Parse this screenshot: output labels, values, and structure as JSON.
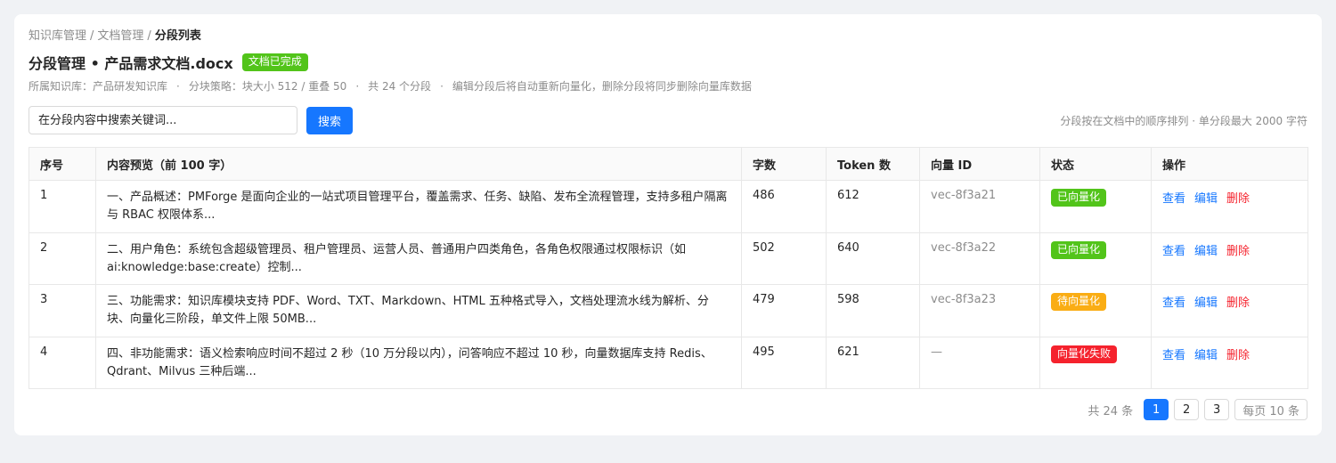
{
  "breadcrumb": {
    "items": [
      "知识库管理",
      "文档管理"
    ],
    "current": "分段列表",
    "separator": "/"
  },
  "header": {
    "title": "分段管理 • 产品需求文档.docx",
    "status_tag": "文档已完成"
  },
  "meta": {
    "knowledge_base": "所属知识库：产品研发知识库",
    "strategy": "分块策略：块大小 512 / 重叠 50",
    "total": "共 24 个分段",
    "note": "编辑分段后将自动重新向量化，删除分段将同步删除向量库数据",
    "dot": "·"
  },
  "search": {
    "placeholder": "在分段内容中搜索关键词...",
    "button_label": "搜索",
    "hint": "分段按在文档中的顺序排列 · 单分段最大 2000 字符"
  },
  "table": {
    "columns": {
      "index": "序号",
      "preview": "内容预览（前 100 字）",
      "chars": "字数",
      "tokens": "Token 数",
      "vector_id": "向量 ID",
      "status": "状态",
      "actions": "操作"
    },
    "rows": [
      {
        "index": "1",
        "preview": "一、产品概述：PMForge 是面向企业的一站式项目管理平台，覆盖需求、任务、缺陷、发布全流程管理，支持多租户隔离与 RBAC 权限体系...",
        "chars": "486",
        "tokens": "612",
        "vector_id": "vec-8f3a21",
        "status": "已向量化",
        "status_color": "#52c41a"
      },
      {
        "index": "2",
        "preview": "二、用户角色：系统包含超级管理员、租户管理员、运营人员、普通用户四类角色，各角色权限通过权限标识（如 ai:knowledge:base:create）控制...",
        "chars": "502",
        "tokens": "640",
        "vector_id": "vec-8f3a22",
        "status": "已向量化",
        "status_color": "#52c41a"
      },
      {
        "index": "3",
        "preview": "三、功能需求：知识库模块支持 PDF、Word、TXT、Markdown、HTML 五种格式导入，文档处理流水线为解析、分块、向量化三阶段，单文件上限 50MB...",
        "chars": "479",
        "tokens": "598",
        "vector_id": "vec-8f3a23",
        "status": "待向量化",
        "status_color": "#faad14"
      },
      {
        "index": "4",
        "preview": "四、非功能需求：语义检索响应时间不超过 2 秒（10 万分段以内），问答响应不超过 10 秒，向量数据库支持 Redis、Qdrant、Milvus 三种后端...",
        "chars": "495",
        "tokens": "621",
        "vector_id": "—",
        "status": "向量化失败",
        "status_color": "#f5222d"
      }
    ],
    "actions": {
      "view": "查看",
      "edit": "编辑",
      "delete": "删除"
    }
  },
  "pagination": {
    "total": "共 24 条",
    "pages": [
      "1",
      "2",
      "3"
    ],
    "current_page": "1",
    "page_size": "每页 10 条"
  }
}
